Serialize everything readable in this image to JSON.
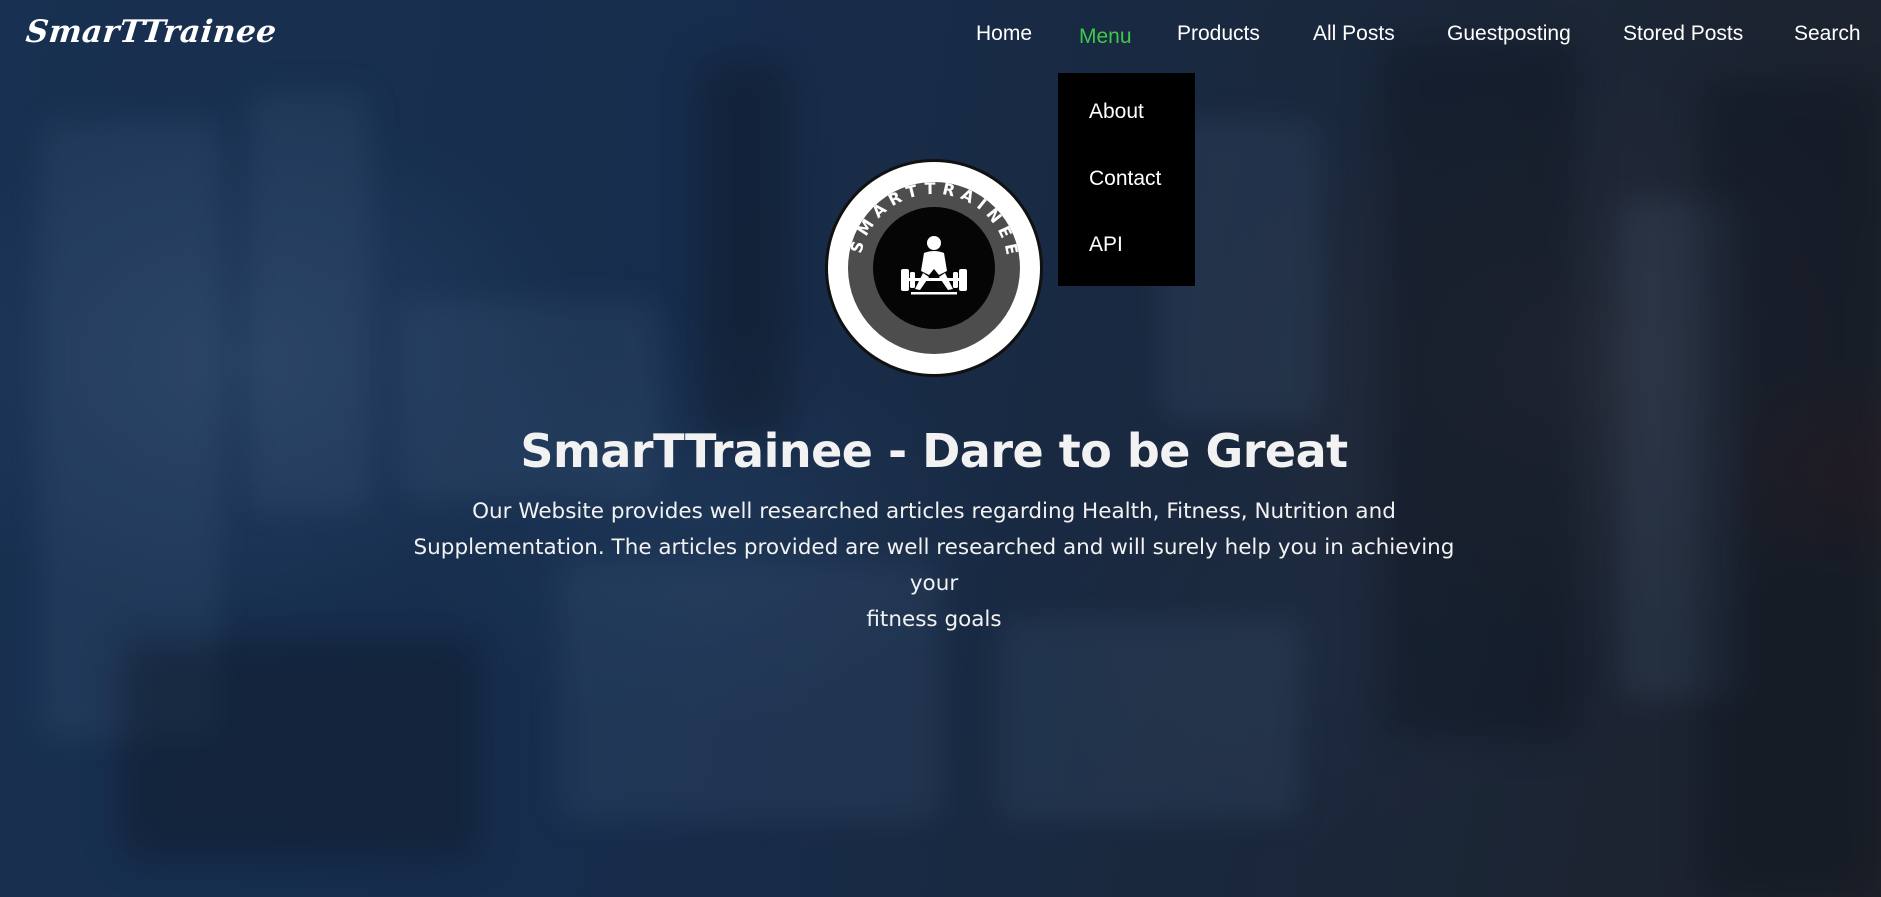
{
  "brand": {
    "name": "SmarTTrainee"
  },
  "nav": {
    "items": [
      {
        "label": "Home"
      },
      {
        "label": "Menu",
        "active": true
      },
      {
        "label": "Products"
      },
      {
        "label": "All Posts"
      },
      {
        "label": "Guestposting"
      },
      {
        "label": "Stored Posts"
      },
      {
        "label": "Search"
      }
    ],
    "active_color": "#3ec94b"
  },
  "dropdown": {
    "items": [
      {
        "label": "About"
      },
      {
        "label": "Contact"
      },
      {
        "label": "API"
      }
    ]
  },
  "logo": {
    "ring_text": "SMARTTRAINEE",
    "icon": "deadlift-lifter-icon"
  },
  "hero": {
    "title": "SmarTTrainee - Dare to be Great",
    "line1": "Our Website provides well researched articles regarding Health, Fitness, Nutrition and",
    "line2": "Supplementation. The articles provided are well researched and will surely help you in achieving your",
    "line3": "fitness goals"
  }
}
